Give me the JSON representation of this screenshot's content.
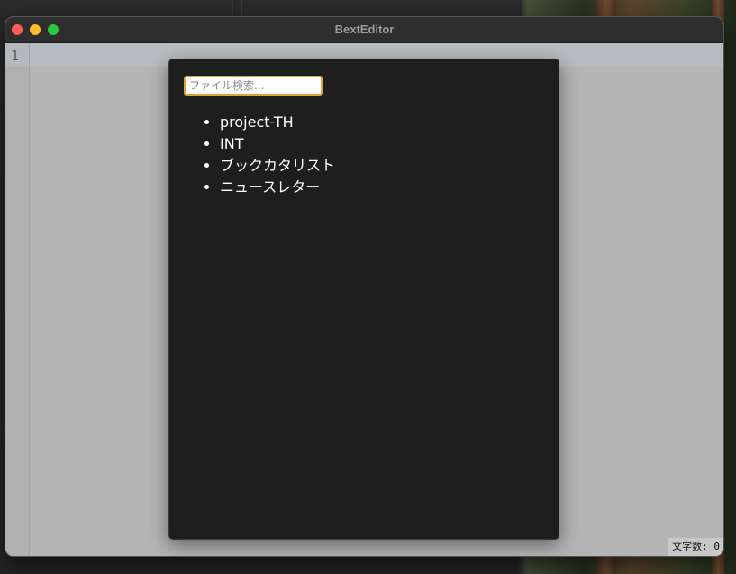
{
  "window": {
    "title": "BextEditor"
  },
  "editor": {
    "line_number": "1",
    "char_count": "文字数: 0"
  },
  "file_picker": {
    "search_placeholder": "ファイル検索...",
    "search_value": "",
    "files": [
      "project-TH",
      "INT",
      "ブックカタリスト",
      "ニュースレター"
    ]
  },
  "colors": {
    "modal_bg": "#1e1e1e",
    "search_focus": "#e0a23a",
    "editor_bg": "#b4b4b4"
  }
}
